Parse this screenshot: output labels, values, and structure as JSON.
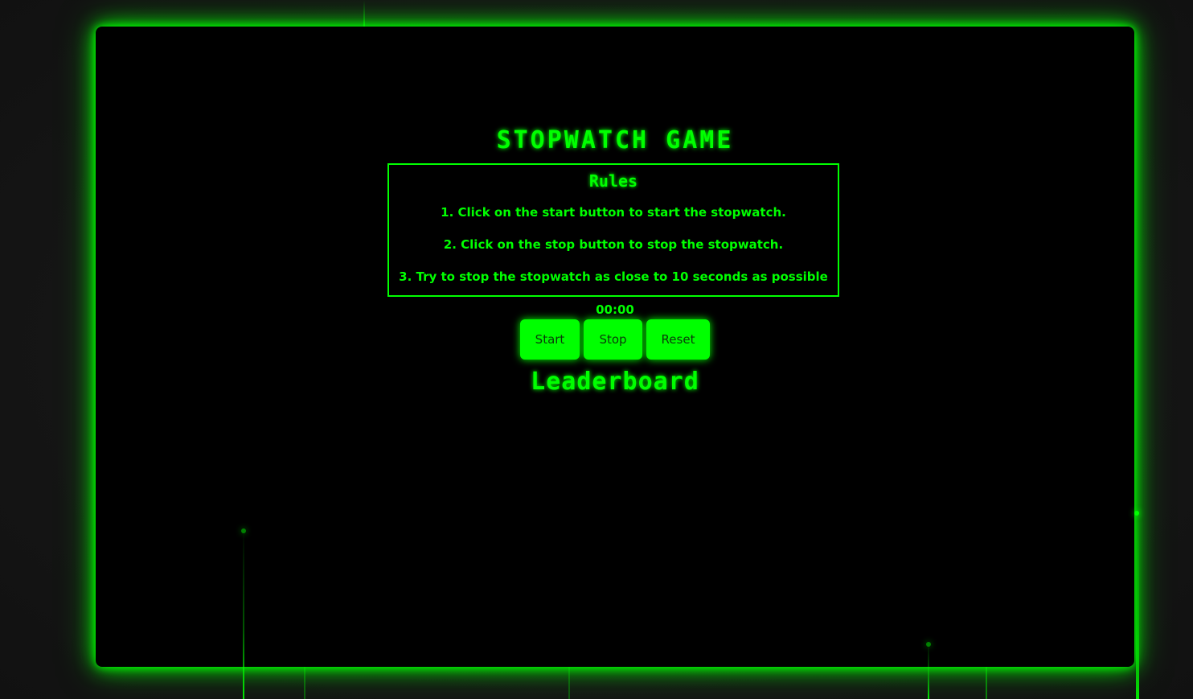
{
  "game": {
    "title": "Stopwatch Game",
    "rules_title": "Rules",
    "rules": [
      "1. Click on the start button to start the stopwatch.",
      "2. Click on the stop button to stop the stopwatch.",
      "3. Try to stop the stopwatch as close to 10 seconds as possible"
    ],
    "timer": "00:00",
    "buttons": {
      "start": "Start",
      "stop": "Stop",
      "reset": "Reset"
    },
    "leaderboard_title": "Leaderboard"
  },
  "colors": {
    "accent": "#00ff00",
    "background": "#000000",
    "page_background": "#151515"
  }
}
